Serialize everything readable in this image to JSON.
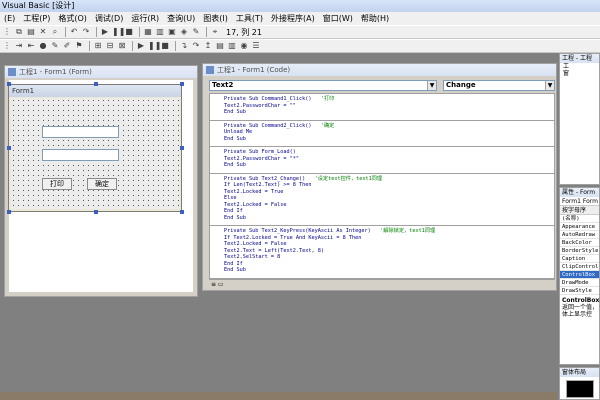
{
  "app": {
    "title": "Visual Basic [设计]"
  },
  "menu": [
    "(E)",
    "工程(P)",
    "格式(O)",
    "调试(D)",
    "运行(R)",
    "查询(U)",
    "图表(I)",
    "工具(T)",
    "外接程序(A)",
    "窗口(W)",
    "帮助(H)"
  ],
  "toolbar": {
    "position": "17, 列 21"
  },
  "form_window": {
    "title": "工程1 - Form1 (Form)",
    "design_form_title": "Form1",
    "button1": "打印",
    "button2": "确定"
  },
  "code_window": {
    "title": "工程1 - Form1 (Code)",
    "object_combo": "Text2",
    "proc_combo": "Change",
    "blocks": [
      [
        {
          "t": "Private Sub Command1_Click()",
          "c": "'打印"
        },
        {
          "t": "Text2.PasswordChar = \"\"",
          "c": ""
        },
        {
          "t": "End Sub",
          "c": ""
        }
      ],
      [
        {
          "t": "Private Sub Command2_Click()",
          "c": "'确定"
        },
        {
          "t": "Unload Me",
          "c": ""
        },
        {
          "t": "End Sub",
          "c": ""
        }
      ],
      [
        {
          "t": "Private Sub Form_Load()",
          "c": ""
        },
        {
          "t": "Text2.PasswordChar = \"*\"",
          "c": ""
        },
        {
          "t": "End Sub",
          "c": ""
        }
      ],
      [
        {
          "t": "Private Sub Text2_Change()",
          "c": "'设定text控件，text1同理"
        },
        {
          "t": "If Len(Text2.Text) >= 8 Then",
          "c": ""
        },
        {
          "t": "Text2.Locked = True",
          "c": ""
        },
        {
          "t": "Else",
          "c": ""
        },
        {
          "t": "Text2.Locked = False",
          "c": ""
        },
        {
          "t": "End If",
          "c": ""
        },
        {
          "t": "End Sub",
          "c": ""
        }
      ],
      [
        {
          "t": "Private Sub Text2_KeyPress(KeyAscii As Integer)",
          "c": "'解除锁定，text1同理"
        },
        {
          "t": "If Text2.Locked = True And KeyAscii = 8 Then",
          "c": ""
        },
        {
          "t": "Text2.Locked = False",
          "c": ""
        },
        {
          "t": "Text2.Text = Left(Text2.Text, 8)",
          "c": ""
        },
        {
          "t": "Text2.SelStart = 8",
          "c": ""
        },
        {
          "t": "End If",
          "c": ""
        },
        {
          "t": "End Sub",
          "c": ""
        }
      ]
    ]
  },
  "project_panel": {
    "title": "工程 - 工程",
    "tree": [
      "工",
      "窗"
    ]
  },
  "properties_panel": {
    "title": "属性 - Form",
    "object": "Form1 Form",
    "tab": "按字母序",
    "rows": [
      "(名称)",
      "Appearance",
      "AutoRedraw",
      "BackColor",
      "BorderStyle",
      "Caption",
      "ClipControls",
      "ControlBox",
      "DrawMode",
      "DrawStyle"
    ],
    "selected_index": 7,
    "desc_title": "ControlBox",
    "desc_text": "返回一个值，\n体上显示控"
  },
  "layout_panel": {
    "title": "窗体布局"
  }
}
